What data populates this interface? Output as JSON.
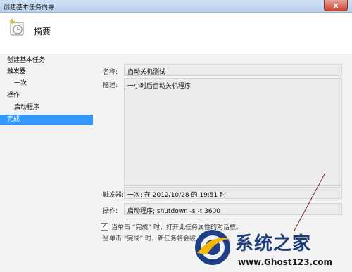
{
  "window": {
    "title": "创建基本任务向导",
    "close_glyph": "x"
  },
  "header": {
    "title": "摘要",
    "icon": "task-clock-icon"
  },
  "sidebar": {
    "items": [
      {
        "label": "创建基本任务"
      },
      {
        "label": "触发器"
      },
      {
        "label": "一次"
      },
      {
        "label": "操作"
      },
      {
        "label": "启动程序"
      },
      {
        "label": "完成"
      }
    ],
    "selected": "完成"
  },
  "summary": {
    "name_label": "名称:",
    "name_value": "自动关机测试",
    "desc_label": "描述:",
    "desc_value": "一小时后自动关机程序",
    "trigger_label": "触发器:",
    "trigger_value": "一次; 在 2012/10/28 的 19:51 时",
    "action_label": "操作:",
    "action_value": "启动程序; shutdown -s -t 3600"
  },
  "option": {
    "checked": true,
    "check_glyph": "✓",
    "label": "当单击 “完成” 时，打开此任务属性的对话框。",
    "note": "当单击 “完成” 时，新任务将会被"
  },
  "watermark": {
    "text": "系统之家",
    "url": "www.Ghost123.com"
  },
  "colors": {
    "selected_bg": "#3399ff",
    "body_bg": "#f3f3f3"
  }
}
